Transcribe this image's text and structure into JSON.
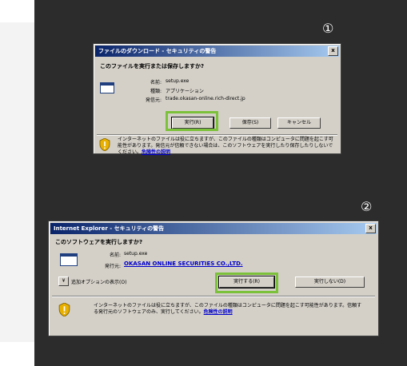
{
  "markers": {
    "one": "①",
    "two": "②"
  },
  "dialog1": {
    "title": "ファイルのダウンロード - セキュリティの警告",
    "close": "x",
    "question": "このファイルを実行または保存しますか?",
    "fields": [
      {
        "label": "名前:",
        "value": "setup.exe"
      },
      {
        "label": "種類:",
        "value": "アプリケーション"
      },
      {
        "label": "発信元:",
        "value": "trade.okasan-online.rich-direct.jp"
      }
    ],
    "buttons": {
      "run": "実行(R)",
      "save": "保存(S)",
      "cancel": "キャンセル"
    },
    "warning_text": "インターネットのファイルは役に立ちますが、このファイルの種類はコンピュータに問題を起こす可能性があります。発信元が信頼できない場合は、このソフトウェアを実行したり保存したりしないでください。",
    "warning_link": "危険性の説明"
  },
  "dialog2": {
    "title": "Internet Explorer - セキュリティの警告",
    "close": "x",
    "question": "このソフトウェアを実行しますか?",
    "name_label": "名前:",
    "name_value": "setup.exe",
    "publisher_label": "発行元:",
    "publisher_value": "OKASAN ONLINE SECURITIES CO.,LTD.",
    "more_options": "追加オプションの表示(O)",
    "more_icon": "chevron-down-icon",
    "buttons": {
      "run": "実行する(R)",
      "dont_run": "実行しない(D)"
    },
    "warning_text": "インターネットのファイルは役に立ちますが、このファイルの種類はコンピュータに問題を起こす可能性があります。信頼する発行元のソフトウェアのみ、実行してください。",
    "warning_link": "危険性の説明"
  },
  "colors": {
    "highlight": "#7cc13a",
    "panel": "#2c2c2c",
    "titlebar": "#0a246a"
  }
}
